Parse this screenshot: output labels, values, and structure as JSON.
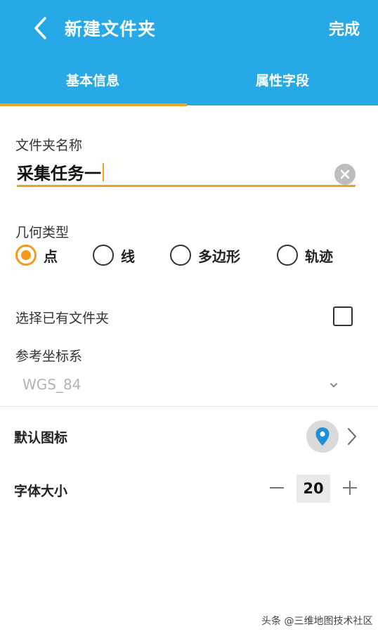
{
  "header": {
    "title": "新建文件夹",
    "done_label": "完成",
    "bg_color": "#26a9e6",
    "accent_color": "#f3a31b"
  },
  "tabs": [
    {
      "label": "基本信息",
      "active": true
    },
    {
      "label": "属性字段",
      "active": false
    }
  ],
  "folder_name": {
    "label": "文件夹名称",
    "value": "采集任务一"
  },
  "geometry_type": {
    "label": "几何类型",
    "options": [
      {
        "label": "点",
        "checked": true
      },
      {
        "label": "线",
        "checked": false
      },
      {
        "label": "多边形",
        "checked": false
      },
      {
        "label": "轨迹",
        "checked": false
      }
    ]
  },
  "select_existing": {
    "label": "选择已有文件夹",
    "checked": false
  },
  "reference_crs": {
    "label": "参考坐标系",
    "value": "WGS_84"
  },
  "default_icon": {
    "label": "默认图标",
    "icon": "map-pin-icon"
  },
  "font_size": {
    "label": "字体大小",
    "value": "20"
  },
  "watermark": "头条 @三维地图技术社区"
}
